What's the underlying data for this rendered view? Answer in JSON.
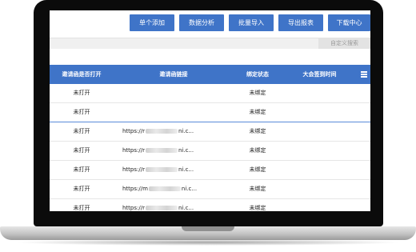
{
  "toolbar": {
    "buttons": [
      "单个添加",
      "数据分析",
      "批量导入",
      "导出报表",
      "下载中心"
    ],
    "search_label": "自定义搜索"
  },
  "table": {
    "headers": [
      "邀请函是否打开",
      "邀请函链接",
      "绑定状态",
      "大会签到时间"
    ],
    "rows": [
      {
        "opened": "未打开",
        "link_prefix": "",
        "link_suffix": "",
        "status": "未绑定"
      },
      {
        "opened": "未打开",
        "link_prefix": "",
        "link_suffix": "",
        "status": "未绑定"
      },
      {
        "opened": "未打开",
        "link_prefix": "https://r",
        "link_suffix": "ni.c...",
        "status": "未绑定"
      },
      {
        "opened": "未打开",
        "link_prefix": "https://r",
        "link_suffix": "ni.c...",
        "status": "未绑定"
      },
      {
        "opened": "未打开",
        "link_prefix": "https://r",
        "link_suffix": "ni.c...",
        "status": "未绑定"
      },
      {
        "opened": "未打开",
        "link_prefix": "https://m",
        "link_suffix": "ni.c...",
        "status": "未绑定"
      },
      {
        "opened": "未打开",
        "link_prefix": "https://r",
        "link_suffix": "ni.c...",
        "status": "未绑定"
      }
    ]
  },
  "colors": {
    "accent": "#3f74c8"
  }
}
